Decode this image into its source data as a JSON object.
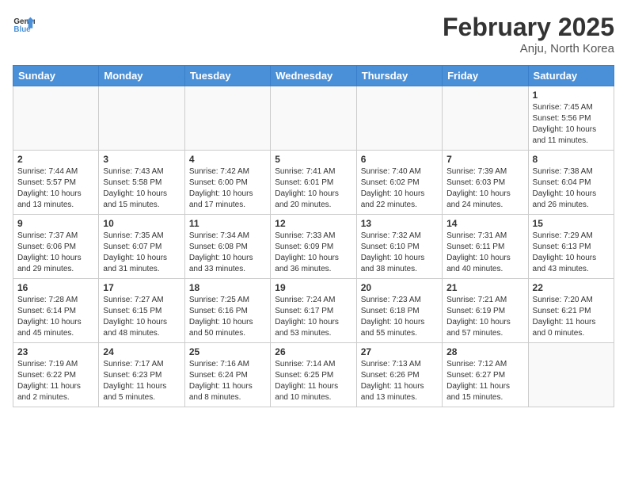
{
  "header": {
    "logo_line1": "General",
    "logo_line2": "Blue",
    "month": "February 2025",
    "location": "Anju, North Korea"
  },
  "weekdays": [
    "Sunday",
    "Monday",
    "Tuesday",
    "Wednesday",
    "Thursday",
    "Friday",
    "Saturday"
  ],
  "weeks": [
    [
      {
        "day": "",
        "info": ""
      },
      {
        "day": "",
        "info": ""
      },
      {
        "day": "",
        "info": ""
      },
      {
        "day": "",
        "info": ""
      },
      {
        "day": "",
        "info": ""
      },
      {
        "day": "",
        "info": ""
      },
      {
        "day": "1",
        "info": "Sunrise: 7:45 AM\nSunset: 5:56 PM\nDaylight: 10 hours and 11 minutes."
      }
    ],
    [
      {
        "day": "2",
        "info": "Sunrise: 7:44 AM\nSunset: 5:57 PM\nDaylight: 10 hours and 13 minutes."
      },
      {
        "day": "3",
        "info": "Sunrise: 7:43 AM\nSunset: 5:58 PM\nDaylight: 10 hours and 15 minutes."
      },
      {
        "day": "4",
        "info": "Sunrise: 7:42 AM\nSunset: 6:00 PM\nDaylight: 10 hours and 17 minutes."
      },
      {
        "day": "5",
        "info": "Sunrise: 7:41 AM\nSunset: 6:01 PM\nDaylight: 10 hours and 20 minutes."
      },
      {
        "day": "6",
        "info": "Sunrise: 7:40 AM\nSunset: 6:02 PM\nDaylight: 10 hours and 22 minutes."
      },
      {
        "day": "7",
        "info": "Sunrise: 7:39 AM\nSunset: 6:03 PM\nDaylight: 10 hours and 24 minutes."
      },
      {
        "day": "8",
        "info": "Sunrise: 7:38 AM\nSunset: 6:04 PM\nDaylight: 10 hours and 26 minutes."
      }
    ],
    [
      {
        "day": "9",
        "info": "Sunrise: 7:37 AM\nSunset: 6:06 PM\nDaylight: 10 hours and 29 minutes."
      },
      {
        "day": "10",
        "info": "Sunrise: 7:35 AM\nSunset: 6:07 PM\nDaylight: 10 hours and 31 minutes."
      },
      {
        "day": "11",
        "info": "Sunrise: 7:34 AM\nSunset: 6:08 PM\nDaylight: 10 hours and 33 minutes."
      },
      {
        "day": "12",
        "info": "Sunrise: 7:33 AM\nSunset: 6:09 PM\nDaylight: 10 hours and 36 minutes."
      },
      {
        "day": "13",
        "info": "Sunrise: 7:32 AM\nSunset: 6:10 PM\nDaylight: 10 hours and 38 minutes."
      },
      {
        "day": "14",
        "info": "Sunrise: 7:31 AM\nSunset: 6:11 PM\nDaylight: 10 hours and 40 minutes."
      },
      {
        "day": "15",
        "info": "Sunrise: 7:29 AM\nSunset: 6:13 PM\nDaylight: 10 hours and 43 minutes."
      }
    ],
    [
      {
        "day": "16",
        "info": "Sunrise: 7:28 AM\nSunset: 6:14 PM\nDaylight: 10 hours and 45 minutes."
      },
      {
        "day": "17",
        "info": "Sunrise: 7:27 AM\nSunset: 6:15 PM\nDaylight: 10 hours and 48 minutes."
      },
      {
        "day": "18",
        "info": "Sunrise: 7:25 AM\nSunset: 6:16 PM\nDaylight: 10 hours and 50 minutes."
      },
      {
        "day": "19",
        "info": "Sunrise: 7:24 AM\nSunset: 6:17 PM\nDaylight: 10 hours and 53 minutes."
      },
      {
        "day": "20",
        "info": "Sunrise: 7:23 AM\nSunset: 6:18 PM\nDaylight: 10 hours and 55 minutes."
      },
      {
        "day": "21",
        "info": "Sunrise: 7:21 AM\nSunset: 6:19 PM\nDaylight: 10 hours and 57 minutes."
      },
      {
        "day": "22",
        "info": "Sunrise: 7:20 AM\nSunset: 6:21 PM\nDaylight: 11 hours and 0 minutes."
      }
    ],
    [
      {
        "day": "23",
        "info": "Sunrise: 7:19 AM\nSunset: 6:22 PM\nDaylight: 11 hours and 2 minutes."
      },
      {
        "day": "24",
        "info": "Sunrise: 7:17 AM\nSunset: 6:23 PM\nDaylight: 11 hours and 5 minutes."
      },
      {
        "day": "25",
        "info": "Sunrise: 7:16 AM\nSunset: 6:24 PM\nDaylight: 11 hours and 8 minutes."
      },
      {
        "day": "26",
        "info": "Sunrise: 7:14 AM\nSunset: 6:25 PM\nDaylight: 11 hours and 10 minutes."
      },
      {
        "day": "27",
        "info": "Sunrise: 7:13 AM\nSunset: 6:26 PM\nDaylight: 11 hours and 13 minutes."
      },
      {
        "day": "28",
        "info": "Sunrise: 7:12 AM\nSunset: 6:27 PM\nDaylight: 11 hours and 15 minutes."
      },
      {
        "day": "",
        "info": ""
      }
    ]
  ]
}
